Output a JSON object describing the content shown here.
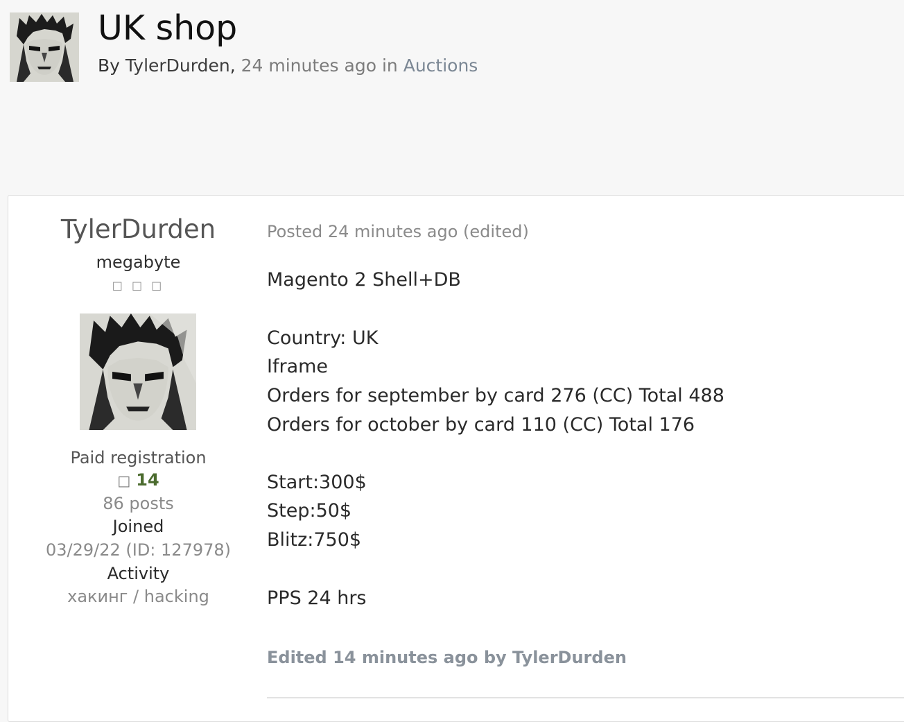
{
  "topic": {
    "title": "UK shop",
    "by_prefix": "By",
    "author": "TylerDurden",
    "comma": ",",
    "time": "24 minutes ago",
    "in_word": "in",
    "forum": "Auctions"
  },
  "author_panel": {
    "name": "TylerDurden",
    "rank": "megabyte",
    "rank_pips": "□ □ □",
    "group": "Paid registration",
    "reputation_icon": "□",
    "reputation": "14",
    "posts": "86 posts",
    "joined_label": "Joined",
    "joined_value": "03/29/22 (ID: 127978)",
    "activity_label": "Activity",
    "activity_value": "хакинг / hacking"
  },
  "post": {
    "date": "Posted 24 minutes ago (edited)",
    "lines": [
      "Magento 2 Shell+DB",
      "Country: UK",
      "Iframe",
      "Orders for september by card 276 (CC) Total 488",
      "Orders for october by card 110 (CC) Total 176",
      "Start:300$",
      "Step:50$",
      "Blitz:750$",
      "PPS 24 hrs"
    ],
    "edited_note": "Edited 14 minutes ago by TylerDurden"
  },
  "colors": {
    "page_bg": "#f7f7f7",
    "card_bg": "#ffffff",
    "muted_text": "#8a8a8a",
    "reputation": "#4b6b2e",
    "forum_link": "#7b8794"
  },
  "icons": {
    "header_avatar": "portrait-avatar",
    "author_photo": "portrait-avatar",
    "reputation": "reputation-icon"
  }
}
